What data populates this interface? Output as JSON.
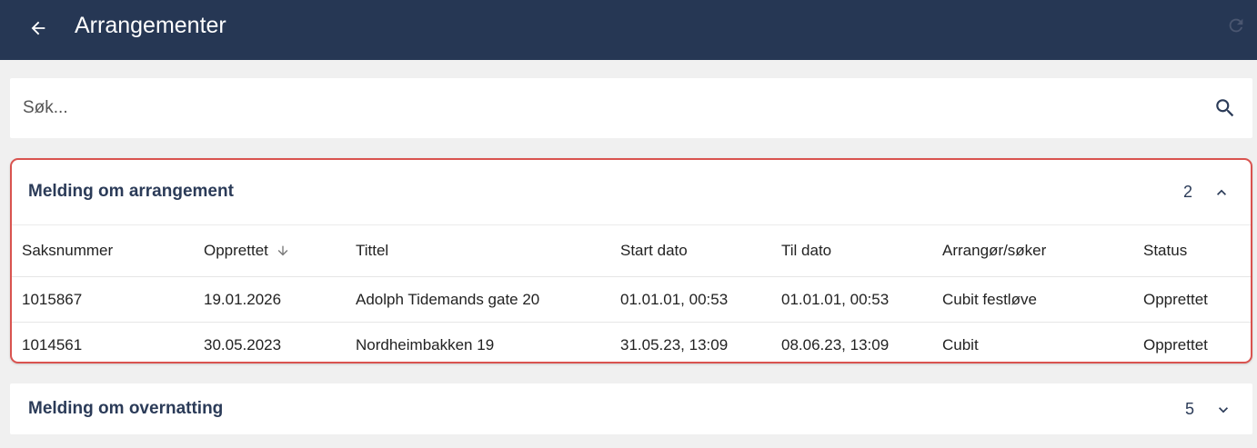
{
  "header": {
    "title": "Arrangementer",
    "back_icon": "arrow-left-icon",
    "refresh_icon": "refresh-icon",
    "background": "#263754"
  },
  "search": {
    "placeholder": "Søk...",
    "value": "",
    "icon": "search-icon"
  },
  "sections": [
    {
      "title": "Melding om arrangement",
      "count": "2",
      "expanded": true,
      "highlight_color": "#d9534f",
      "columns": [
        "Saksnummer",
        "Opprettet",
        "Tittel",
        "Start dato",
        "Til dato",
        "Arrangør/søker",
        "Status"
      ],
      "sorted_column": "Opprettet",
      "sort_icon": "arrow-down-icon",
      "rows": [
        [
          "1015867",
          "19.01.2026",
          "Adolph Tidemands gate 20",
          "01.01.01, 00:53",
          "01.01.01, 00:53",
          "Cubit festløve",
          "Opprettet"
        ],
        [
          "1014561",
          "30.05.2023",
          "Nordheimbakken 19",
          "31.05.23, 13:09",
          "08.06.23, 13:09",
          "Cubit",
          "Opprettet"
        ]
      ]
    },
    {
      "title": "Melding om overnatting",
      "count": "5",
      "expanded": false
    }
  ]
}
